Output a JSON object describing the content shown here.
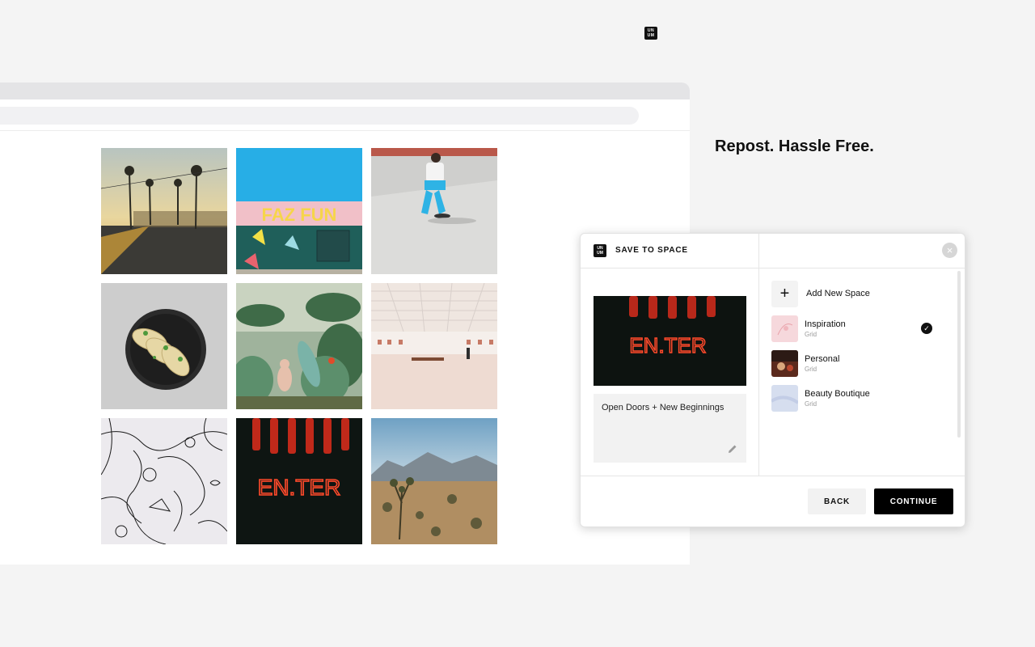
{
  "tagline": "Repost. Hassle Free.",
  "extension": {
    "logo_top": "UN",
    "logo_bottom": "UM"
  },
  "grid": {
    "tiles": [
      {
        "name": "street-palms-photo"
      },
      {
        "name": "mural-wall-photo",
        "text": "FAZ FUN"
      },
      {
        "name": "skateboarder-photo"
      },
      {
        "name": "tacos-plate-photo"
      },
      {
        "name": "jungle-painting-photo"
      },
      {
        "name": "gallery-room-photo"
      },
      {
        "name": "doodle-drawing-photo"
      },
      {
        "name": "enter-neon-photo",
        "text": "EN.TER"
      },
      {
        "name": "desert-joshua-tree-photo"
      }
    ]
  },
  "modal": {
    "title": "SAVE TO SPACE",
    "logo_top": "UN",
    "logo_bottom": "UM",
    "close_icon": "close-icon",
    "preview_text": "EN.TER",
    "caption": "Open Doors + New Beginnings",
    "add_space_label": "Add New Space",
    "spaces": [
      {
        "name": "Inspiration",
        "type": "Grid",
        "selected": true
      },
      {
        "name": "Personal",
        "type": "Grid",
        "selected": false
      },
      {
        "name": "Beauty Boutique",
        "type": "Grid",
        "selected": false
      }
    ],
    "back_label": "BACK",
    "continue_label": "CONTINUE"
  },
  "colors": {
    "accent": "#000000",
    "neon": "#ff3b1f",
    "background": "#f4f4f4"
  }
}
